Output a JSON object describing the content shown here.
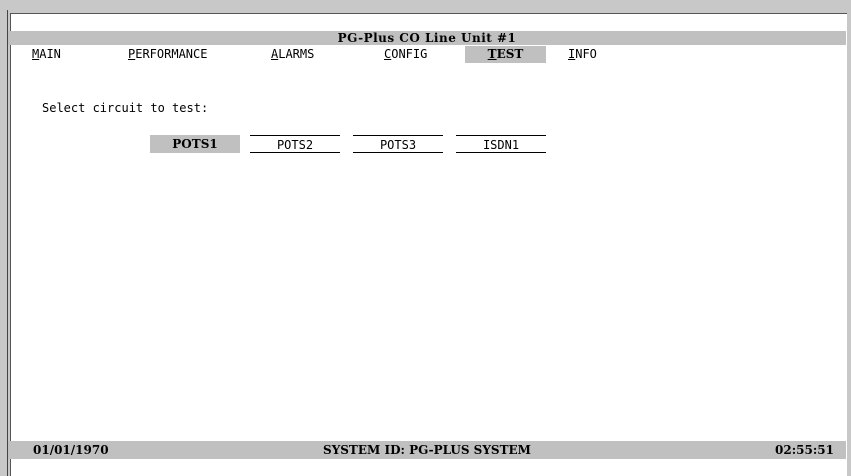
{
  "window": {
    "title": "PG-Plus CO Line Unit #1"
  },
  "menu": [
    {
      "hot": "M",
      "rest": "AIN"
    },
    {
      "hot": "P",
      "rest": "ERFORMANCE"
    },
    {
      "hot": "A",
      "rest": "LARMS"
    },
    {
      "hot": "C",
      "rest": "ONFIG"
    },
    {
      "hot": "T",
      "rest": "EST",
      "active": true
    },
    {
      "hot": "I",
      "rest": "NFO"
    }
  ],
  "test": {
    "prompt": "Select circuit to test:",
    "circuits": [
      "POTS1",
      "POTS2",
      "POTS3",
      "ISDN1"
    ],
    "selected": "POTS1"
  },
  "status": {
    "date": "01/01/1970",
    "system_id": "SYSTEM ID: PG-PLUS SYSTEM",
    "time": "02:55:51"
  },
  "colors": {
    "bar_gray": "#c0c0c0",
    "frame_gray": "#c8c8c8"
  }
}
